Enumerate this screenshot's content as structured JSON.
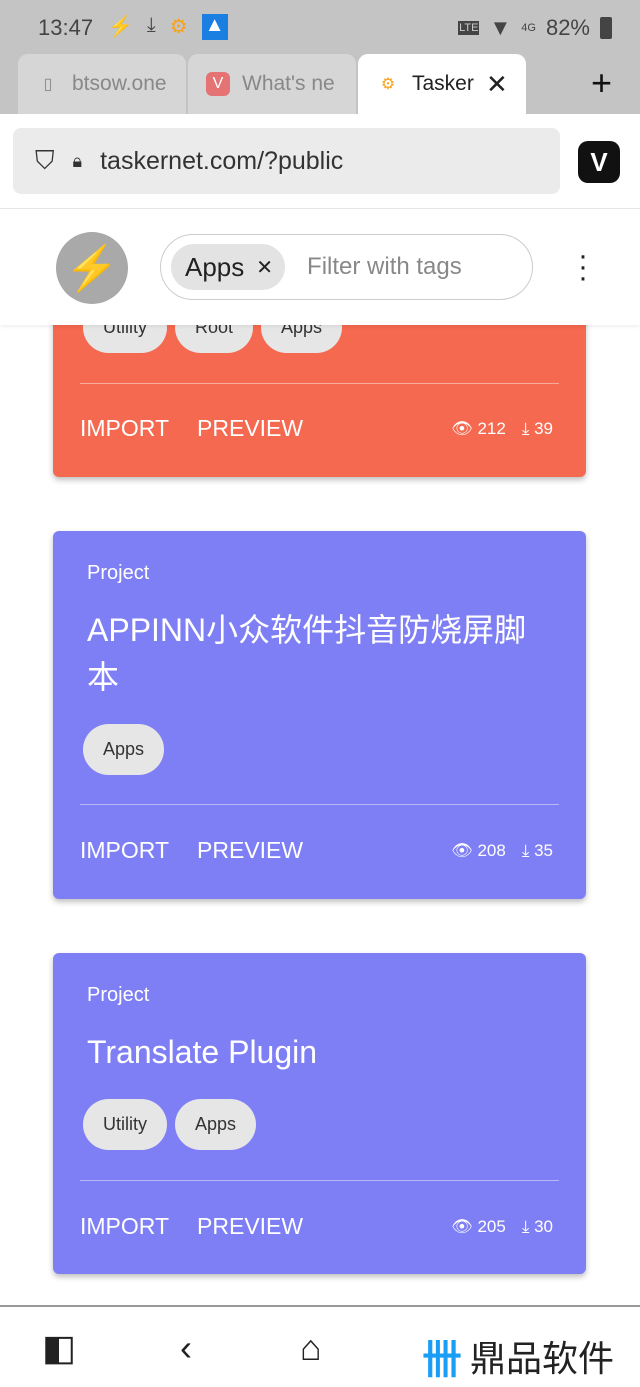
{
  "status": {
    "time": "13:47",
    "battery": "82%",
    "network": "4G"
  },
  "tabs": [
    {
      "label": "btsow.one",
      "active": false
    },
    {
      "label": "What's ne",
      "active": false
    },
    {
      "label": "TaskerN",
      "active": true
    }
  ],
  "url": "taskernet.com/?public",
  "filter": {
    "chip": "Apps",
    "placeholder": "Filter with tags"
  },
  "cards": [
    {
      "type": "",
      "title": "",
      "tags": [
        "Utility",
        "Root",
        "Apps"
      ],
      "color": "#f4694f",
      "views": "212",
      "downloads": "39"
    },
    {
      "type": "Project",
      "title": "APPINN小众软件抖音防烧屏脚本",
      "tags": [
        "Apps"
      ],
      "color": "#7f7ff5",
      "views": "208",
      "downloads": "35"
    },
    {
      "type": "Project",
      "title": "Translate Plugin",
      "tags": [
        "Utility",
        "Apps"
      ],
      "color": "#7f7ff5",
      "views": "205",
      "downloads": "30"
    }
  ],
  "actions": {
    "import": "IMPORT",
    "preview": "PREVIEW"
  },
  "watermark": "鼎品软件"
}
